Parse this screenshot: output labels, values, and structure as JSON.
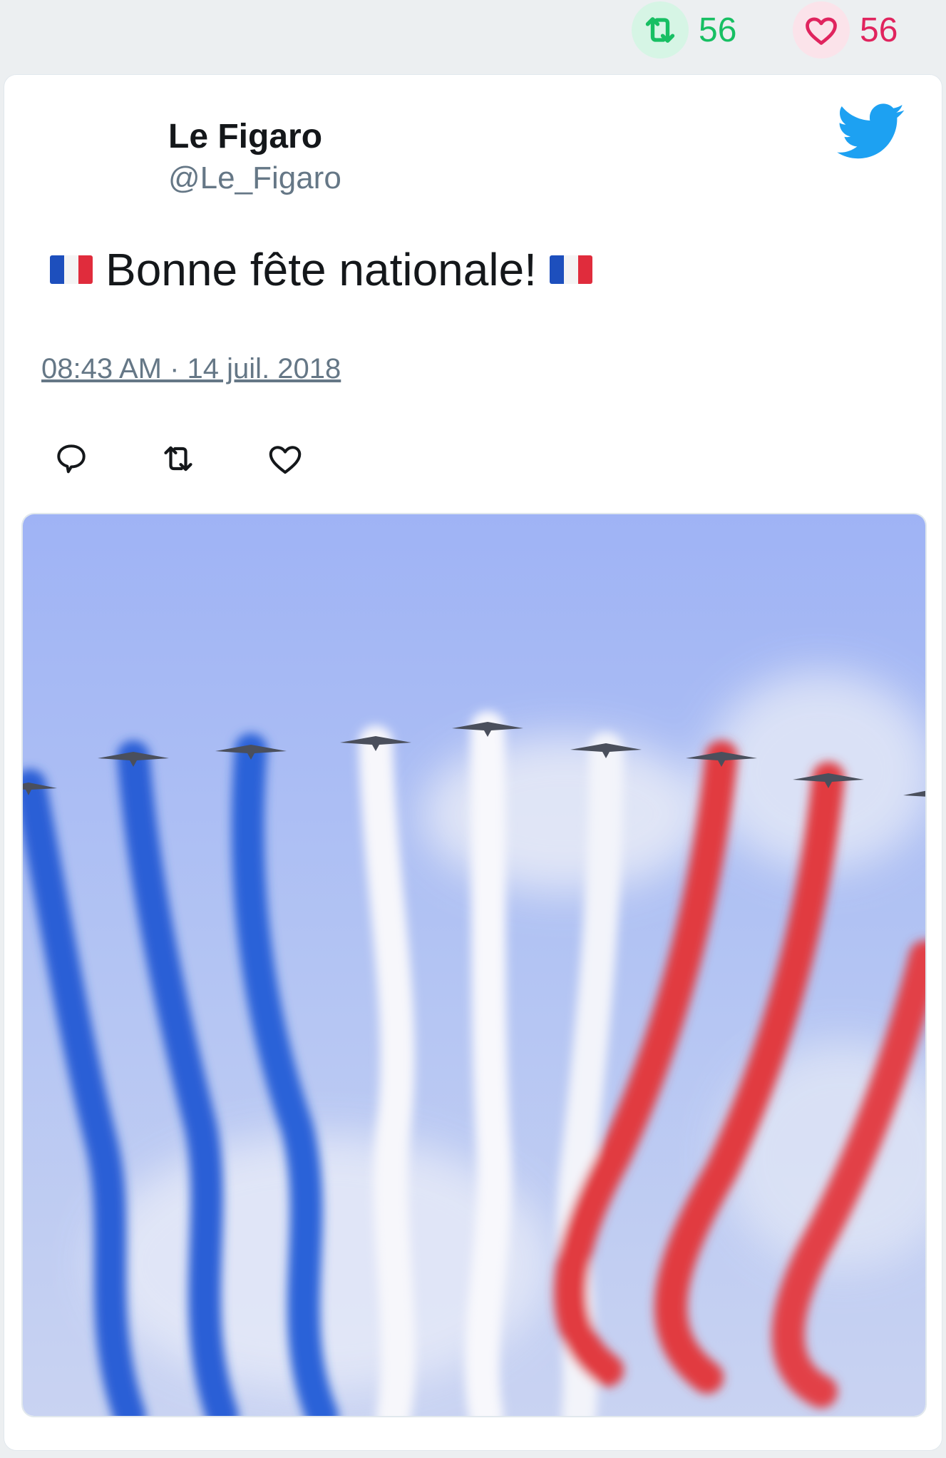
{
  "stats": {
    "retweet_count": "56",
    "like_count": "56",
    "retweet_color": "#17bf63",
    "like_color": "#e0245e"
  },
  "tweet": {
    "author_name": "Le Figaro",
    "author_handle": "@Le_Figaro",
    "text": "Bonne fête nationale!",
    "timestamp": "08:43 AM · 14 juil. 2018",
    "platform_icon": "twitter-bird-icon",
    "accent_color": "#1da1f2"
  },
  "actions": {
    "reply_icon": "reply-icon",
    "retweet_icon": "retweet-icon",
    "like_icon": "heart-icon"
  },
  "media": {
    "type": "photo",
    "smoke_colors": [
      "#2a5fd6",
      "#ffffff",
      "#e13a3f"
    ]
  }
}
